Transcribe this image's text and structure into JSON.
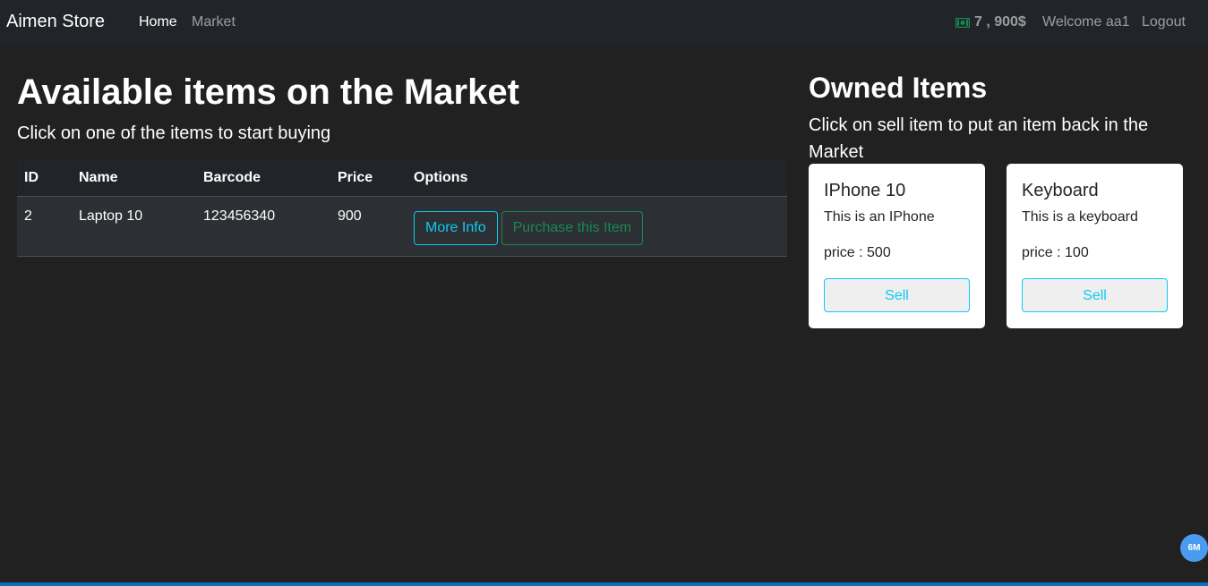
{
  "navbar": {
    "brand": "Aimen Store",
    "links": [
      "Home",
      "Market"
    ],
    "balance": "7 , 900$",
    "welcome": "Welcome aa1",
    "logout": "Logout"
  },
  "market": {
    "title": "Available items on the Market",
    "subtitle": "Click on one of the items to start buying",
    "headers": [
      "ID",
      "Name",
      "Barcode",
      "Price",
      "Options"
    ],
    "rows": [
      {
        "id": "2",
        "name": "Laptop 10",
        "barcode": "123456340",
        "price": "900",
        "more_info": "More Info",
        "purchase": "Purchase this Item"
      }
    ]
  },
  "owned": {
    "title": "Owned Items",
    "subtitle": "Click on sell item to put an item back in the Market",
    "items": [
      {
        "name": "IPhone 10",
        "description": "This is an IPhone",
        "price": "price : 500",
        "sell": "Sell"
      },
      {
        "name": "Keyboard",
        "description": "This is a keyboard",
        "price": "price : 100",
        "sell": "Sell"
      }
    ]
  },
  "badge": "6M",
  "colors": {
    "info": "#0dcaf0",
    "success": "#198754",
    "background": "#212121",
    "cash_icon": "#198754"
  }
}
